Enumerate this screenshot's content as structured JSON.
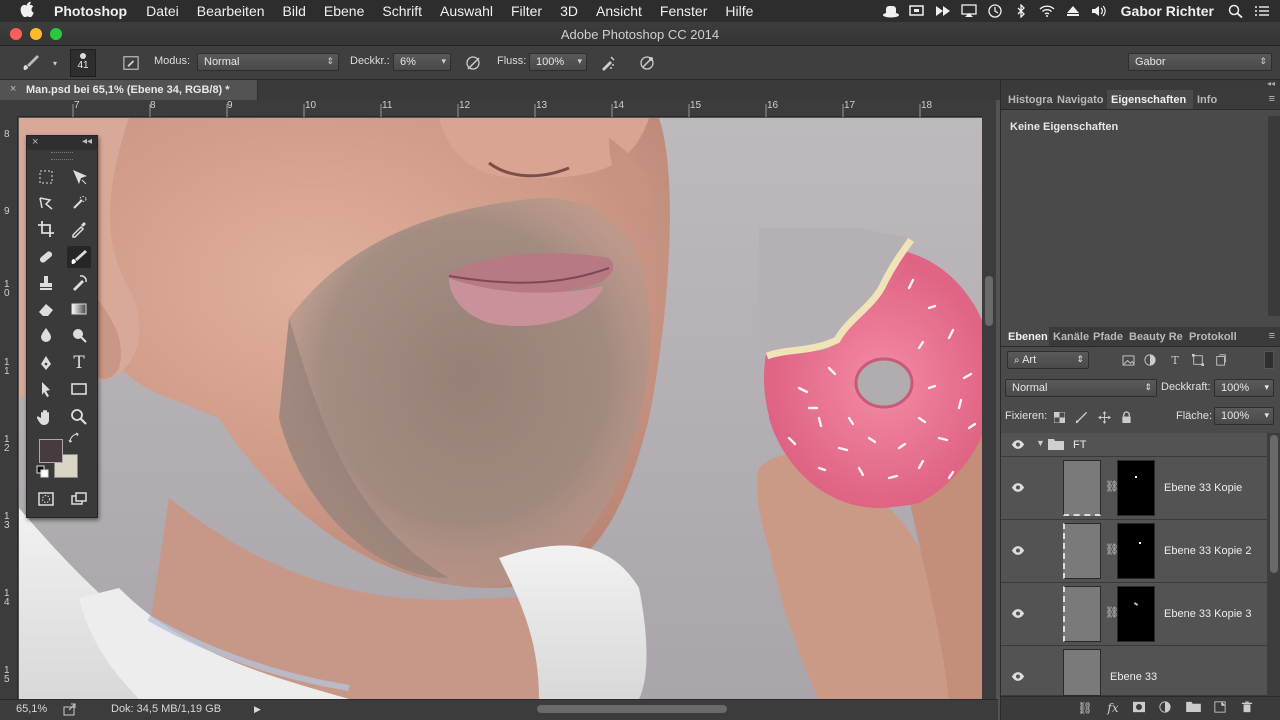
{
  "menubar": {
    "app_name": "Photoshop",
    "items": [
      "Datei",
      "Bearbeiten",
      "Bild",
      "Ebene",
      "Schrift",
      "Auswahl",
      "Filter",
      "3D",
      "Ansicht",
      "Fenster",
      "Hilfe"
    ],
    "user": "Gabor Richter"
  },
  "window": {
    "title": "Adobe Photoshop CC 2014"
  },
  "options": {
    "brush_size": "41",
    "mode_label": "Modus:",
    "mode_value": "Normal",
    "opacity_label": "Deckkr.:",
    "opacity_value": "6%",
    "flow_label": "Fluss:",
    "flow_value": "100%",
    "workspace": "Gabor"
  },
  "document": {
    "tab_title": "Man.psd bei 65,1% (Ebene 34, RGB/8) *"
  },
  "rulers": {
    "horizontal": [
      "7",
      "8",
      "9",
      "10",
      "11",
      "12",
      "13",
      "14",
      "15",
      "16",
      "17",
      "18"
    ],
    "vertical": [
      "8",
      "9",
      "1 0",
      "1 1",
      "1 2",
      "1 3",
      "1 4",
      "1 5"
    ]
  },
  "status": {
    "zoom": "65,1%",
    "doc_info": "Dok: 34,5 MB/1,19 GB"
  },
  "properties_panel": {
    "tabs": [
      "Histogra",
      "Navigato",
      "Eigenschaften",
      "Info"
    ],
    "active_tab": "Eigenschaften",
    "empty_text": "Keine Eigenschaften"
  },
  "layers_panel": {
    "tabs": [
      "Ebenen",
      "Kanäle",
      "Pfade",
      "Beauty Re",
      "Protokoll"
    ],
    "filter_kind": "Art",
    "blend_mode": "Normal",
    "opacity_label": "Deckkraft:",
    "opacity_value": "100%",
    "lock_label": "Fixieren:",
    "fill_label": "Fläche:",
    "fill_value": "100%",
    "group_name": "FT",
    "layers": [
      {
        "name": "Ebene 33 Kopie"
      },
      {
        "name": "Ebene 33 Kopie 2"
      },
      {
        "name": "Ebene 33 Kopie 3"
      },
      {
        "name": "Ebene 33"
      }
    ]
  },
  "colors": {
    "foreground": "#473b40",
    "background": "#d9d6c4",
    "donut_icing": "#e8708c"
  }
}
